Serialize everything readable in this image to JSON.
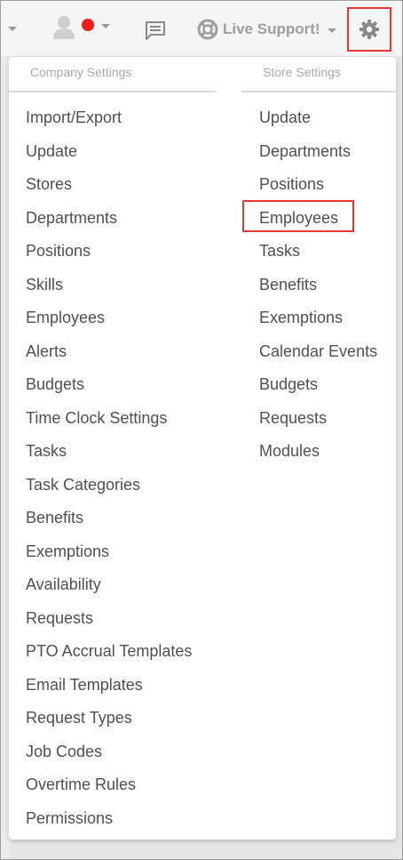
{
  "topbar": {
    "support_label": "Live Support!"
  },
  "colors": {
    "accent_red": "#e53935",
    "notification_dot": "#ee1c1c",
    "menu_text": "#505050",
    "header_text": "#a9a9a9"
  },
  "icons": [
    "caret-down-icon",
    "user-avatar-icon",
    "notification-dot",
    "chat-icon",
    "life-ring-icon",
    "gear-icon"
  ],
  "company_settings": {
    "header": "Company Settings",
    "items": [
      "Import/Export",
      "Update",
      "Stores",
      "Departments",
      "Positions",
      "Skills",
      "Employees",
      "Alerts",
      "Budgets",
      "Time Clock Settings",
      "Tasks",
      "Task Categories",
      "Benefits",
      "Exemptions",
      "Availability",
      "Requests",
      "PTO Accrual Templates",
      "Email Templates",
      "Request Types",
      "Job Codes",
      "Overtime Rules",
      "Permissions"
    ]
  },
  "store_settings": {
    "header": "Store Settings",
    "highlighted_item": "Employees",
    "items": [
      "Update",
      "Departments",
      "Positions",
      "Employees",
      "Tasks",
      "Benefits",
      "Exemptions",
      "Calendar Events",
      "Budgets",
      "Requests",
      "Modules"
    ]
  }
}
